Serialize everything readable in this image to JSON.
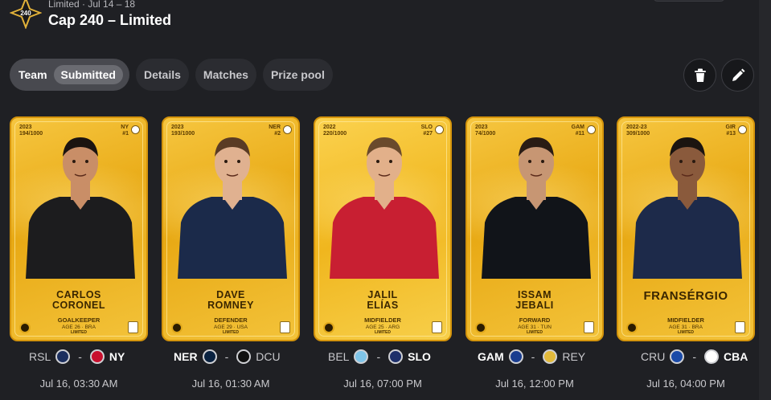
{
  "header": {
    "subtitle": "Limited · Jul 14 – 18",
    "title": "Cap 240 – Limited",
    "logo_icon": "star-badge-icon",
    "logo_text": "240"
  },
  "tabs": [
    {
      "label": "Team",
      "badge": "Submitted",
      "active": true
    },
    {
      "label": "Details"
    },
    {
      "label": "Matches"
    },
    {
      "label": "Prize pool"
    }
  ],
  "actions": {
    "delete_icon": "trash-icon",
    "edit_icon": "pencil-icon"
  },
  "cards": [
    {
      "season": "2023",
      "serial": "194/1000",
      "team_code": "NY",
      "number": "#1",
      "name_line1": "CARLOS",
      "name_line2": "CORONEL",
      "position": "GOALKEEPER",
      "age": "AGE 26",
      "country": "BRA",
      "rarity": "LIMITED",
      "jersey_color": "#1c1c1e",
      "skin": "#c98e67",
      "hair": "#1b1410"
    },
    {
      "season": "2023",
      "serial": "193/1000",
      "team_code": "NER",
      "number": "#2",
      "name_line1": "DAVE",
      "name_line2": "ROMNEY",
      "position": "DEFENDER",
      "age": "AGE 29",
      "country": "USA",
      "rarity": "LIMITED",
      "jersey_color": "#1b2a4a",
      "skin": "#e0b190",
      "hair": "#5a3b24"
    },
    {
      "season": "2022",
      "serial": "220/1000",
      "team_code": "SLO",
      "number": "#27",
      "name_line1": "JALIL",
      "name_line2": "ELÍAS",
      "position": "MIDFIELDER",
      "age": "AGE 25",
      "country": "ARG",
      "rarity": "LIMITED",
      "jersey_color": "#c81f32",
      "skin": "#e2b08a",
      "hair": "#6a4a2c"
    },
    {
      "season": "2023",
      "serial": "74/1000",
      "team_code": "GAM",
      "number": "#11",
      "name_line1": "ISSAM",
      "name_line2": "JEBALI",
      "position": "FORWARD",
      "age": "AGE 31",
      "country": "TUN",
      "rarity": "LIMITED",
      "jersey_color": "#111419",
      "skin": "#c79673",
      "hair": "#2a1c14"
    },
    {
      "season": "2022-23",
      "serial": "309/1000",
      "team_code": "GIR",
      "number": "#13",
      "name_line1": "FRANSÉRGIO",
      "name_line2": "",
      "position": "MIDFIELDER",
      "age": "AGE 31",
      "country": "BRA",
      "rarity": "LIMITED",
      "jersey_color": "#1d2a4a",
      "skin": "#8a5a3c",
      "hair": "#1b1410"
    }
  ],
  "matches": [
    {
      "home": "RSL",
      "home_bold": false,
      "home_color": "#1c2f5e",
      "away": "NY",
      "away_bold": true,
      "away_color": "#c8102e",
      "time": "Jul 16, 03:30 AM"
    },
    {
      "home": "NER",
      "home_bold": true,
      "home_color": "#0a2240",
      "away": "DCU",
      "away_bold": false,
      "away_color": "#111111",
      "time": "Jul 16, 01:30 AM"
    },
    {
      "home": "BEL",
      "home_bold": false,
      "home_color": "#7fc4e8",
      "away": "SLO",
      "away_bold": true,
      "away_color": "#1d2f6a",
      "time": "Jul 16, 07:00 PM"
    },
    {
      "home": "GAM",
      "home_bold": true,
      "home_color": "#1a3d8f",
      "away": "REY",
      "away_bold": false,
      "away_color": "#e2b93b",
      "time": "Jul 16, 12:00 PM"
    },
    {
      "home": "CRU",
      "home_bold": false,
      "home_color": "#1a4aa8",
      "away": "CBA",
      "away_bold": true,
      "away_color": "#ffffff",
      "time": "Jul 16, 04:00 PM"
    }
  ]
}
